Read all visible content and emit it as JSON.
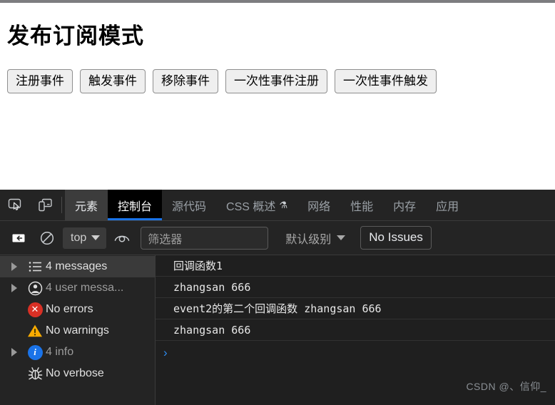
{
  "page": {
    "title": "发布订阅模式",
    "buttons": [
      {
        "label": "注册事件"
      },
      {
        "label": "触发事件"
      },
      {
        "label": "移除事件"
      },
      {
        "label": "一次性事件注册"
      },
      {
        "label": "一次性事件触发"
      }
    ]
  },
  "devtools": {
    "tabs": [
      {
        "label": "元素",
        "state": "hovered"
      },
      {
        "label": "控制台",
        "state": "active"
      },
      {
        "label": "源代码",
        "state": "normal"
      },
      {
        "label": "CSS 概述",
        "state": "normal",
        "icon": "flask-icon"
      },
      {
        "label": "网络",
        "state": "normal"
      },
      {
        "label": "性能",
        "state": "normal"
      },
      {
        "label": "内存",
        "state": "normal"
      },
      {
        "label": "应用",
        "state": "normal"
      }
    ],
    "toolbar": {
      "context_value": "top",
      "filter_placeholder": "筛选器",
      "filter_value": "",
      "level_label": "默认级别",
      "issues_label": "No Issues"
    },
    "sidebar": [
      {
        "label": "4 messages",
        "icon": "list-icon",
        "expandable": true,
        "selected": true,
        "dim": false
      },
      {
        "label": "4 user messa...",
        "icon": "user-icon",
        "expandable": true,
        "selected": false,
        "dim": true
      },
      {
        "label": "No errors",
        "icon": "error-icon",
        "expandable": false,
        "selected": false,
        "dim": false
      },
      {
        "label": "No warnings",
        "icon": "warning-icon",
        "expandable": false,
        "selected": false,
        "dim": false
      },
      {
        "label": "4 info",
        "icon": "info-icon",
        "expandable": true,
        "selected": false,
        "dim": true
      },
      {
        "label": "No verbose",
        "icon": "bug-icon",
        "expandable": false,
        "selected": false,
        "dim": false
      }
    ],
    "messages": [
      {
        "text": "回调函数1"
      },
      {
        "text": "zhangsan  666"
      },
      {
        "text": "event2的第二个回调函数  zhangsan  666"
      },
      {
        "text": "zhangsan  666"
      }
    ],
    "prompt_symbol": "›",
    "watermark": "CSDN @、信仰_"
  },
  "colors": {
    "accent": "#1a73e8",
    "error": "#d93025",
    "warning": "#f9ab00",
    "devtools_bg": "#242424",
    "console_bg": "#1f1f1f"
  }
}
